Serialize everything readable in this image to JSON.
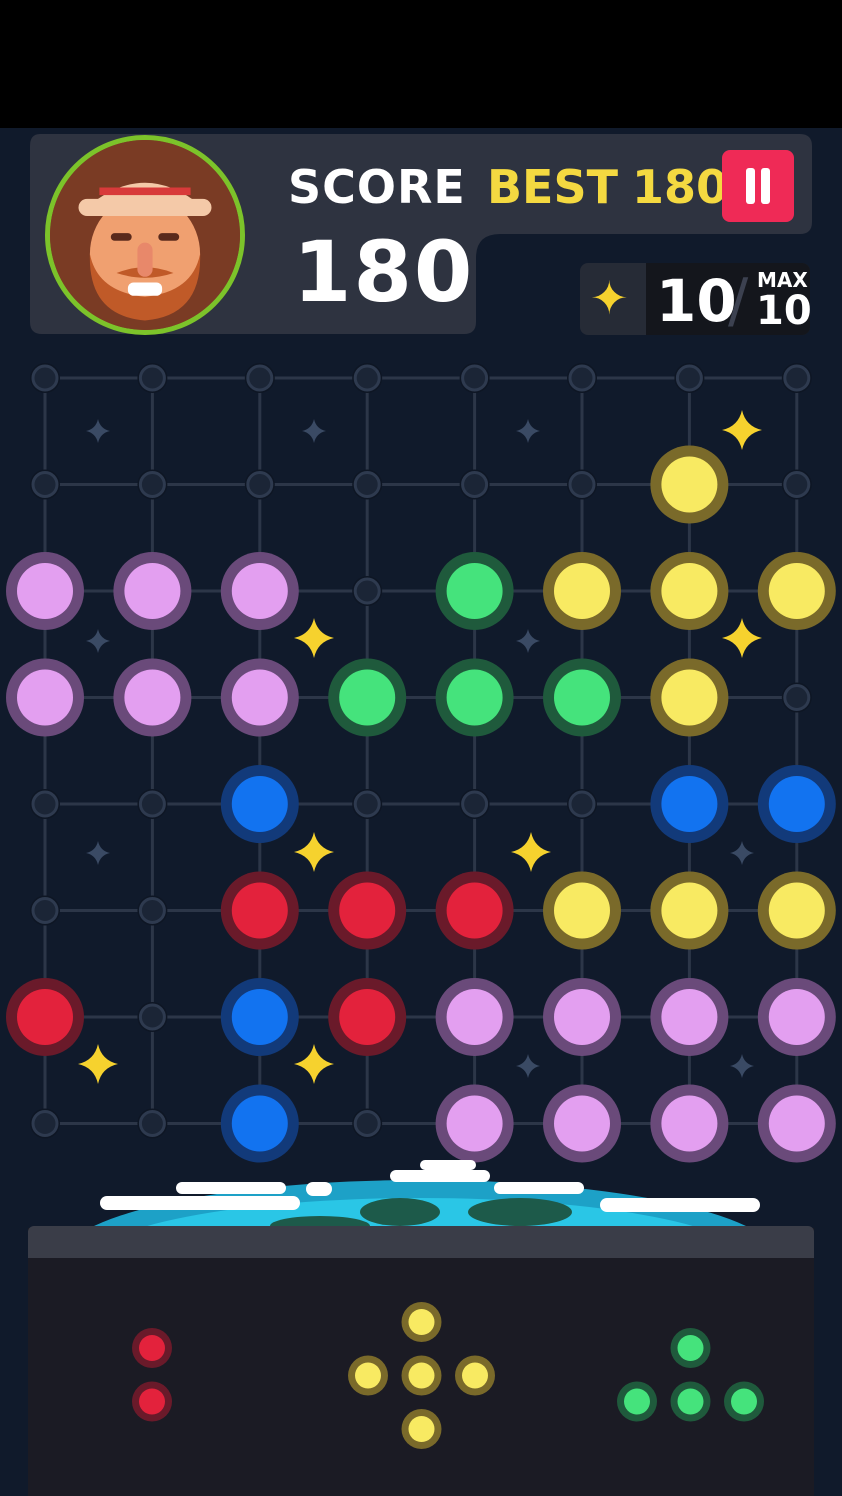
{
  "hud": {
    "score_label": "SCORE",
    "score_value": "180",
    "best_label": "BEST",
    "best_value": "180",
    "moves_value": "10",
    "max_label": "MAX",
    "max_value": "10"
  },
  "icons": {
    "pause": "pause-icon",
    "moves": "star-icon",
    "avatar": "character-avatar"
  },
  "colors": {
    "background": "#101a2b",
    "pink": "#e39ff0",
    "green": "#45e37c",
    "yellow": "#f8ea62",
    "blue": "#1273f0",
    "red": "#e3223c",
    "empty": "#1b2536",
    "accent_yellow": "#f4d941",
    "pause_red": "#ef2a56"
  },
  "board": {
    "columns": 8,
    "rows": 8,
    "cells": [
      [
        "empty",
        "empty",
        "empty",
        "empty",
        "empty",
        "empty",
        "empty",
        "empty"
      ],
      [
        "empty",
        "empty",
        "empty",
        "empty",
        "empty",
        "empty",
        "yellow",
        "empty"
      ],
      [
        "pink",
        "pink",
        "pink",
        "empty",
        "green",
        "yellow",
        "yellow",
        "yellow"
      ],
      [
        "pink",
        "pink",
        "pink",
        "green",
        "green",
        "green",
        "yellow",
        "empty"
      ],
      [
        "empty",
        "empty",
        "blue",
        "empty",
        "empty",
        "empty",
        "blue",
        "blue"
      ],
      [
        "empty",
        "empty",
        "red",
        "red",
        "red",
        "yellow",
        "yellow",
        "yellow"
      ],
      [
        "red",
        "empty",
        "blue",
        "red",
        "pink",
        "pink",
        "pink",
        "pink"
      ],
      [
        "empty",
        "empty",
        "blue",
        "empty",
        "pink",
        "pink",
        "pink",
        "pink"
      ]
    ]
  },
  "pieces": [
    {
      "name": "red-vertical-pair",
      "color": "red",
      "cells": [
        [
          0,
          0
        ],
        [
          0,
          1
        ]
      ]
    },
    {
      "name": "yellow-plus",
      "color": "yellow",
      "cells": [
        [
          1,
          0
        ],
        [
          0,
          1
        ],
        [
          1,
          1
        ],
        [
          2,
          1
        ],
        [
          1,
          2
        ]
      ]
    },
    {
      "name": "green-t",
      "color": "green",
      "cells": [
        [
          1,
          0
        ],
        [
          0,
          1
        ],
        [
          1,
          1
        ],
        [
          2,
          1
        ]
      ]
    }
  ]
}
